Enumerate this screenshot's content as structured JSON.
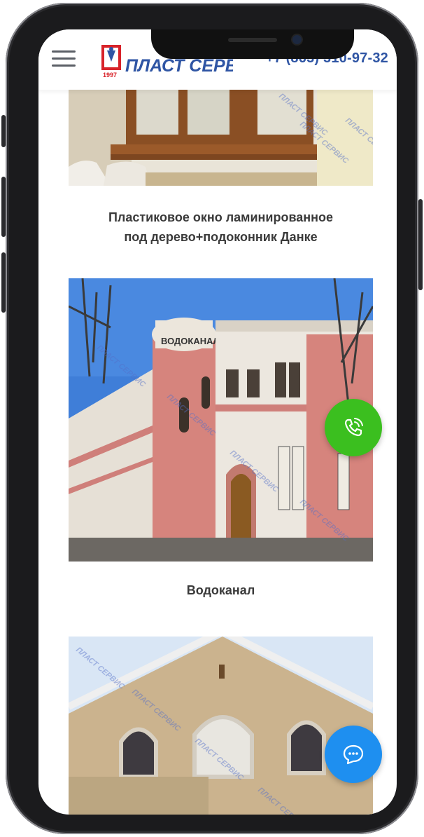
{
  "header": {
    "logo_text": "ПЛАСТ СЕРВИС",
    "logo_year": "1997",
    "phone": "+7 (863) 310-97-32"
  },
  "gallery": [
    {
      "caption_line1": "Пластиковое окно ламинированное",
      "caption_line2": "под дерево+подоконник Данке"
    },
    {
      "caption_line1": "Водоканал",
      "caption_line2": ""
    },
    {
      "caption_line1": "",
      "caption_line2": ""
    }
  ],
  "building_sign": "ВОДОКАНАЛ",
  "watermark": "ПЛАСТ СЕРВИС",
  "colors": {
    "brand_blue": "#2f55a4",
    "call_green": "#3bbf1f",
    "chat_blue": "#1e8ff0"
  },
  "icons": {
    "menu": "hamburger-icon",
    "call": "phone-call-icon",
    "chat": "chat-bubble-icon"
  }
}
